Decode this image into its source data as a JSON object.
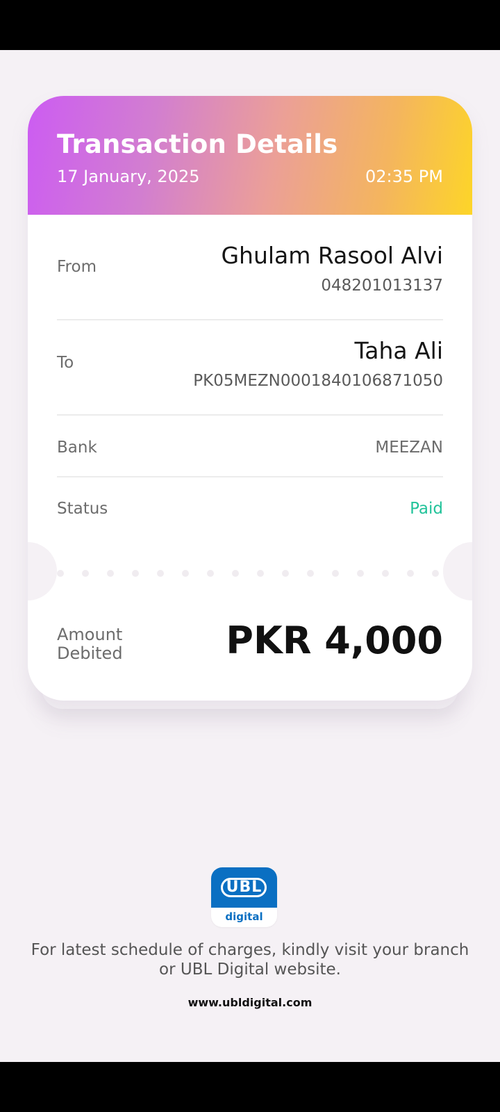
{
  "header": {
    "title": "Transaction Details",
    "date": "17 January, 2025",
    "time": "02:35 PM"
  },
  "rows": {
    "from": {
      "label": "From",
      "name": "Ghulam Rasool Alvi",
      "account": "048201013137"
    },
    "to": {
      "label": "To",
      "name": "Taha Ali",
      "account": "PK05MEZN0001840106871050"
    },
    "bank": {
      "label": "Bank",
      "value": "MEEZAN"
    },
    "status": {
      "label": "Status",
      "value": "Paid"
    }
  },
  "amount": {
    "label_line1": "Amount",
    "label_line2": "Debited",
    "value": "PKR 4,000"
  },
  "footer": {
    "logo_text": "UBL",
    "logo_sub": "digital",
    "note_line1": "For latest schedule of charges, kindly visit your branch",
    "note_line2": "or UBL Digital website.",
    "url": "www.ubldigital.com"
  },
  "colors": {
    "background": "#f5f1f5",
    "status_paid": "#22c39a",
    "brand_blue": "#0a6fc2",
    "header_gradient_start": "#cc5cf2",
    "header_gradient_end": "#fdd528"
  }
}
